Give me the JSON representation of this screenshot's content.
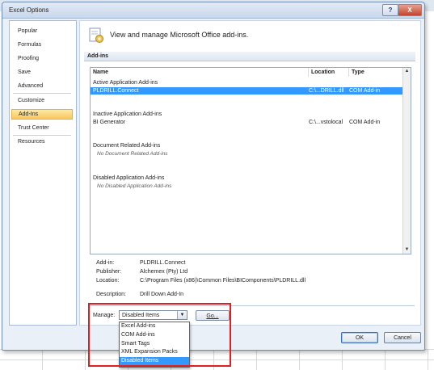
{
  "window": {
    "title": "Excel Options",
    "help_label": "?",
    "close_label": "X"
  },
  "nav": {
    "items": [
      {
        "label": "Popular"
      },
      {
        "label": "Formulas"
      },
      {
        "label": "Proofing"
      },
      {
        "label": "Save"
      },
      {
        "label": "Advanced"
      },
      {
        "label": "Customize"
      },
      {
        "label": "Add-Ins",
        "selected": true
      },
      {
        "label": "Trust Center"
      },
      {
        "label": "Resources"
      }
    ]
  },
  "header": {
    "text": "View and manage Microsoft Office add-ins."
  },
  "addins": {
    "section_title": "Add-ins",
    "columns": [
      "Name",
      "Location",
      "Type"
    ],
    "groups": [
      {
        "title": "Active Application Add-ins",
        "rows": [
          {
            "name": "PLDRILL.Connect",
            "location": "C:\\...DRILL.dll",
            "type": "COM Add-in",
            "selected": true
          }
        ]
      },
      {
        "title": "Inactive Application Add-ins",
        "rows": [
          {
            "name": "BI Generator",
            "location": "C:\\...vstolocal",
            "type": "COM Add-in"
          }
        ]
      },
      {
        "title": "Document Related Add-ins",
        "none": "No Document Related Add-ins"
      },
      {
        "title": "Disabled Application Add-ins",
        "none": "No Disabled Application Add-ins"
      }
    ]
  },
  "details": {
    "addin_label": "Add-in:",
    "addin_value": "PLDRILL.Connect",
    "publisher_label": "Publisher:",
    "publisher_value": "Alchemex (Pty) Ltd",
    "location_label": "Location:",
    "location_value": "C:\\Program Files (x86)\\Common Files\\BIComponents\\PLDRILL.dll",
    "description_label": "Description:",
    "description_value": "Drill Down Add-In"
  },
  "manage": {
    "label": "Manage:",
    "selected": "Disabled Items",
    "go_label": "Go...",
    "options": [
      "Excel Add-ins",
      "COM Add-ins",
      "Smart Tags",
      "XML Expansion Packs",
      "Disabled Items"
    ]
  },
  "buttons": {
    "ok": "OK",
    "cancel": "Cancel"
  },
  "colors": {
    "selection": "#3399ff",
    "nav_selected": "#f9c65a",
    "highlight_box": "#e02020"
  }
}
